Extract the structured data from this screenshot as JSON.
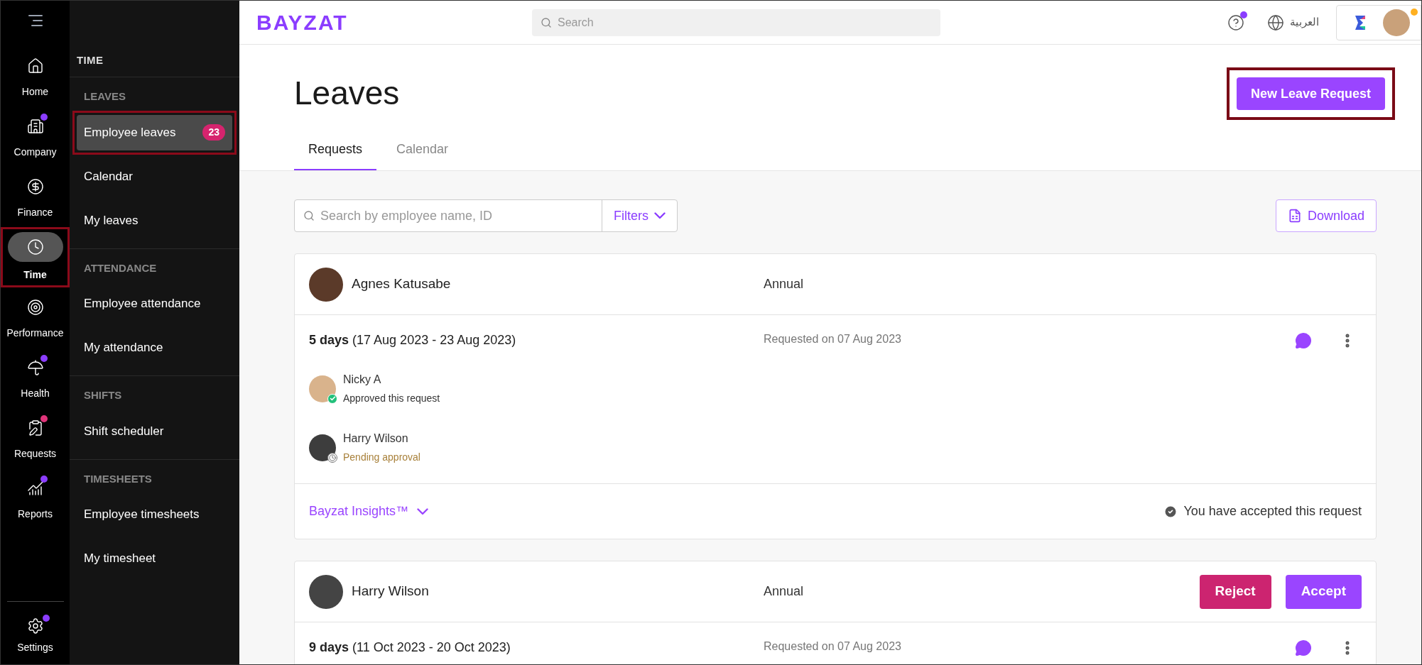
{
  "rail": {
    "items": [
      {
        "label": "Home",
        "selected": false,
        "highlighted": false
      },
      {
        "label": "Company",
        "selected": false,
        "highlighted": false,
        "color": "#8b3dff"
      },
      {
        "label": "Finance",
        "selected": false,
        "highlighted": false
      },
      {
        "label": "Time",
        "selected": true,
        "highlighted": true
      },
      {
        "label": "Performance",
        "selected": false,
        "highlighted": false
      },
      {
        "label": "Health",
        "selected": false,
        "highlighted": false,
        "color": "#8b3dff"
      },
      {
        "label": "Requests",
        "selected": false,
        "highlighted": false,
        "color": "#e0347a"
      },
      {
        "label": "Reports",
        "selected": false,
        "highlighted": false,
        "color": "#8b3dff"
      }
    ],
    "settings": {
      "label": "Settings",
      "color": "#8b3dff"
    }
  },
  "sidebar": {
    "title": "TIME",
    "sections": [
      {
        "heading": "LEAVES",
        "items": [
          {
            "label": "Employee leaves",
            "badge": "23",
            "selected": true,
            "highlighted": true
          },
          {
            "label": "Calendar",
            "selected": false,
            "highlighted": false
          },
          {
            "label": "My leaves",
            "selected": false,
            "highlighted": false
          }
        ]
      },
      {
        "heading": "ATTENDANCE",
        "items": [
          {
            "label": "Employee attendance",
            "selected": false,
            "highlighted": false
          },
          {
            "label": "My attendance",
            "selected": false,
            "highlighted": false
          }
        ]
      },
      {
        "heading": "SHIFTS",
        "items": [
          {
            "label": "Shift scheduler",
            "selected": false,
            "highlighted": false
          }
        ]
      },
      {
        "heading": "TIMESHEETS",
        "items": [
          {
            "label": "Employee timesheets",
            "selected": false,
            "highlighted": false
          },
          {
            "label": "My timesheet",
            "selected": false,
            "highlighted": false
          }
        ]
      }
    ]
  },
  "header": {
    "logo": "BAYZAT",
    "search": {
      "placeholder": "Search"
    },
    "language": "العربية"
  },
  "page": {
    "title": "Leaves",
    "new_button": {
      "label": "New Leave Request",
      "highlighted": true
    },
    "tabs": [
      {
        "label": "Requests",
        "selected": true
      },
      {
        "label": "Calendar",
        "selected": false
      }
    ],
    "employee_search": {
      "placeholder": "Search by employee name, ID"
    },
    "filters": "Filters",
    "download": "Download"
  },
  "requests": [
    {
      "name": "Agnes Katusabe",
      "leave_type": "Annual",
      "days": "5 days",
      "range": "(17 Aug 2023 - 23 Aug 2023)",
      "requested": "Requested on 07 Aug 2023",
      "approvers": [
        {
          "name": "Nicky A",
          "status": "Approved this request",
          "kind": "approved"
        },
        {
          "name": "Harry Wilson",
          "status": "Pending approval",
          "kind": "pending"
        }
      ],
      "insights": "Bayzat Insights™",
      "result": "You have accepted this request"
    },
    {
      "name": "Harry Wilson",
      "leave_type": "Annual",
      "days": "9 days",
      "range": "(11 Oct 2023 - 20 Oct 2023)",
      "requested": "Requested on 07 Aug 2023",
      "actions": [
        "Reject",
        "Accept"
      ]
    }
  ]
}
